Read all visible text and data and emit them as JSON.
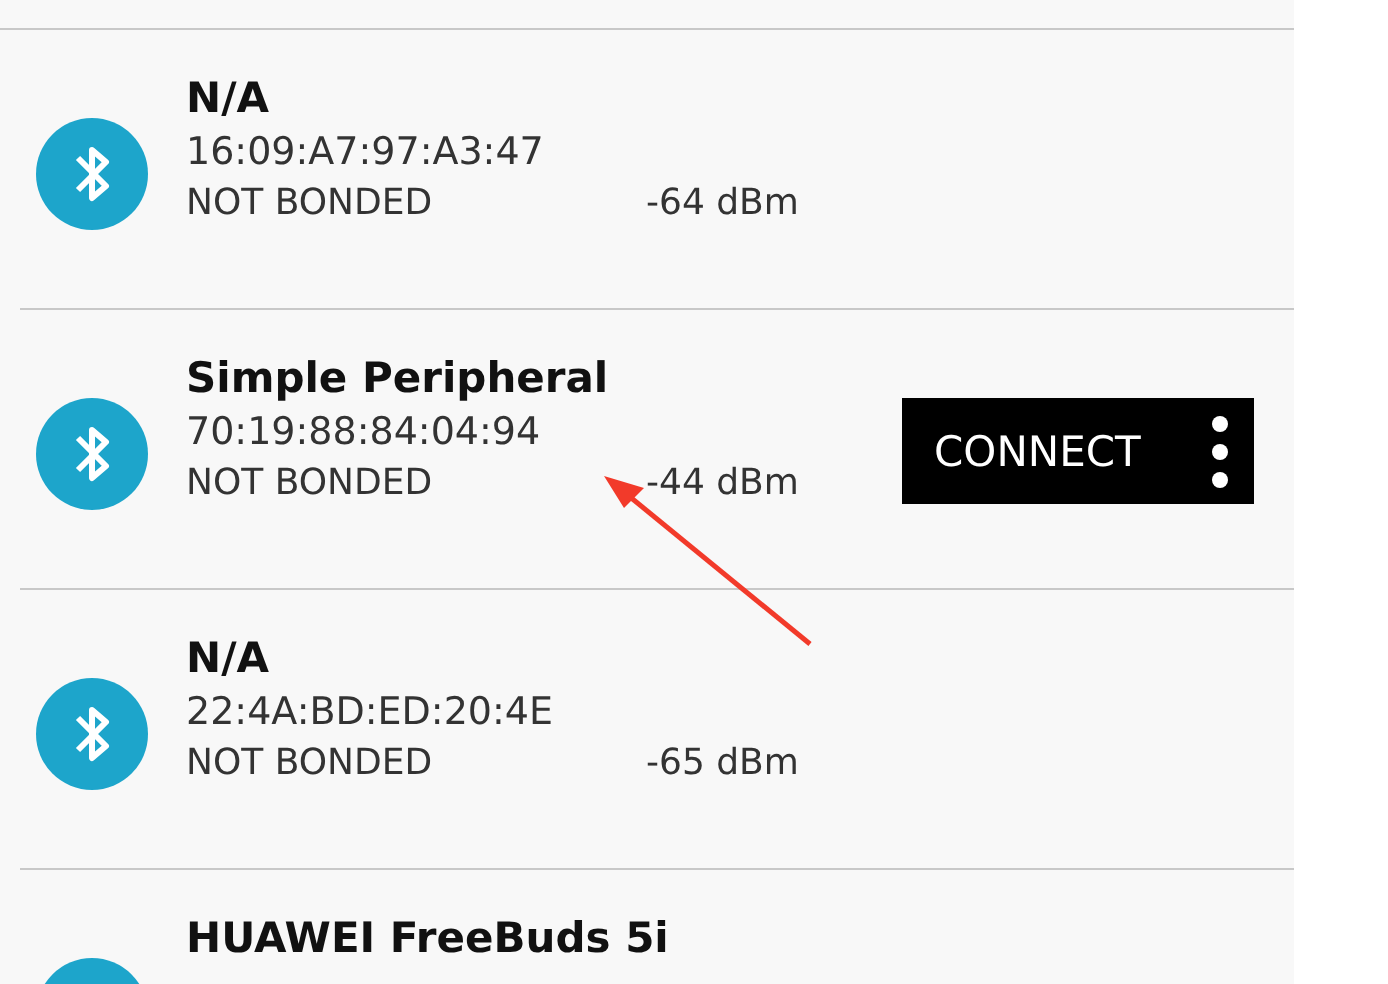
{
  "devices": [
    {
      "name": "N/A",
      "address": "16:09:A7:97:A3:47",
      "bond_state": "NOT BONDED",
      "rssi": "-64 dBm"
    },
    {
      "name": "Simple Peripheral",
      "address": "70:19:88:84:04:94",
      "bond_state": "NOT BONDED",
      "rssi": "-44 dBm",
      "action": {
        "label": "CONNECT"
      }
    },
    {
      "name": "N/A",
      "address": "22:4A:BD:ED:20:4E",
      "bond_state": "NOT BONDED",
      "rssi": "-65 dBm"
    },
    {
      "name": "HUAWEI FreeBuds 5i"
    }
  ],
  "annotation": {
    "kind": "arrow"
  }
}
